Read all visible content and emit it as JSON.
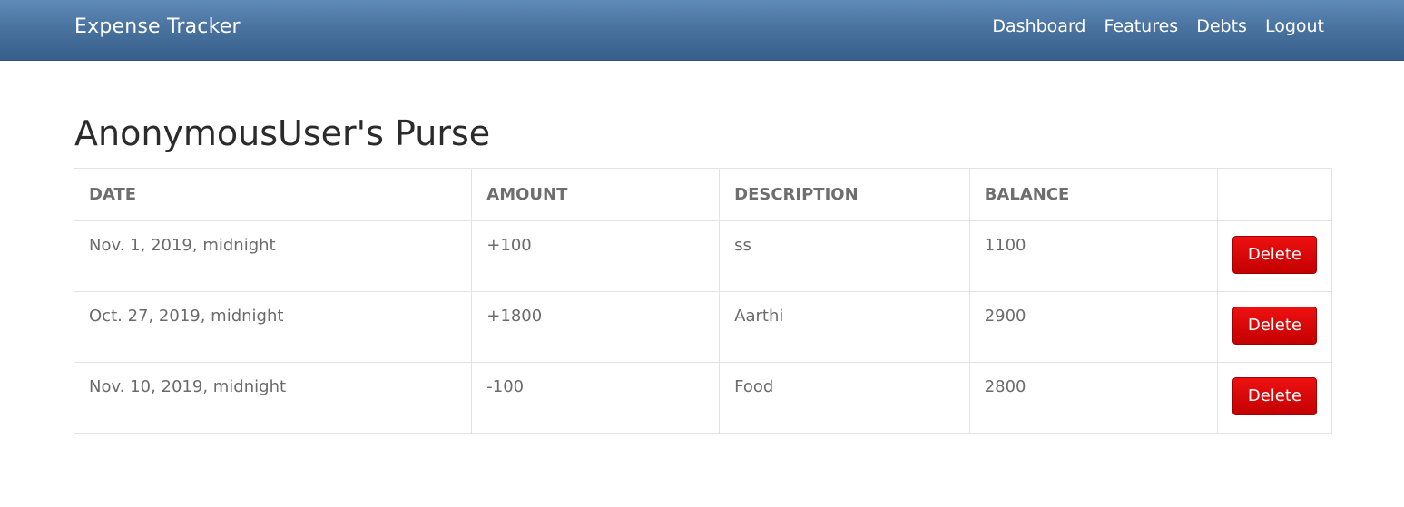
{
  "navbar": {
    "brand": "Expense Tracker",
    "links": [
      {
        "label": "Dashboard"
      },
      {
        "label": "Features"
      },
      {
        "label": "Debts"
      },
      {
        "label": "Logout"
      }
    ]
  },
  "main": {
    "title": "AnonymousUser's Purse",
    "table": {
      "headers": [
        "DATE",
        "AMOUNT",
        "DESCRIPTION",
        "BALANCE",
        ""
      ],
      "rows": [
        {
          "date": "Nov. 1, 2019, midnight",
          "amount": "+100",
          "amount_type": "positive",
          "description": "ss",
          "balance": "1100",
          "action": "Delete"
        },
        {
          "date": "Oct. 27, 2019, midnight",
          "amount": "+1800",
          "amount_type": "positive",
          "description": "Aarthi",
          "balance": "2900",
          "action": "Delete"
        },
        {
          "date": "Nov. 10, 2019, midnight",
          "amount": "-100",
          "amount_type": "negative",
          "description": "Food",
          "balance": "2800",
          "action": "Delete"
        }
      ]
    }
  },
  "colors": {
    "navbar": "#4a73a0",
    "positive": "#2b8a1f",
    "negative": "#e0201a",
    "delete_button": "#d40000"
  }
}
